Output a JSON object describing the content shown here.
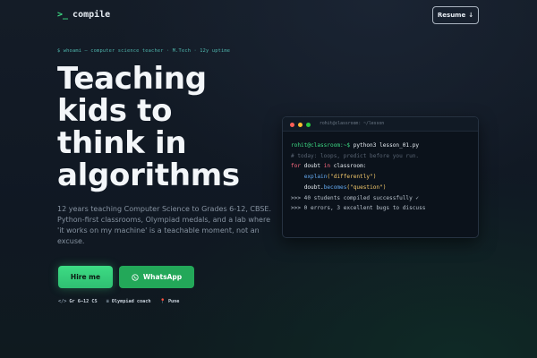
{
  "nav": {
    "logo_prompt": ">_",
    "logo_text": "compile",
    "resume_label": "Resume",
    "resume_icon": "↓"
  },
  "hero": {
    "whoami": "$ whoami — computer science teacher · M.Tech · 12y uptime",
    "headline_lines": [
      "Teaching",
      "kids to",
      "think in",
      "algorithms"
    ],
    "description": "12 years teaching Computer Science to Grades 6-12, CBSE. Python-first classrooms, Olympiad medals, and a lab where 'it works on my machine' is a teachable moment, not an excuse.",
    "hire_label": "Hire me",
    "whatsapp_label": "WhatsApp",
    "meta": [
      {
        "icon": "</>",
        "label": "Gr 6–12 CS"
      },
      {
        "icon": "≡",
        "label": "Olympiad coach"
      },
      {
        "icon": "📍",
        "label": "Pune"
      }
    ]
  },
  "terminal": {
    "title": "rohit@classroom: ~/lesson",
    "prompt": "rohit@classroom:~$",
    "command": " python3 lesson_01.py",
    "comment": "# today: loops, predict before you run.",
    "kw_for": "for",
    "var_doubt": " doubt ",
    "kw_in": "in",
    "classroom": " classroom:",
    "indent": "    ",
    "explain": "explain",
    "explain_arg": "(\"differently\")",
    "doubt_obj": "doubt.",
    "becomes": "becomes",
    "becomes_arg": "(\"question\")",
    "out1": ">>> 40 students compiled successfully ✓",
    "out2": ">>> 0 errors, 3 excellent bugs to discuss"
  },
  "colors": {
    "accent_green": "#3ddc84",
    "whatsapp_green": "#23a859",
    "background": "#141c27",
    "terminal_bg": "#0b121b"
  }
}
